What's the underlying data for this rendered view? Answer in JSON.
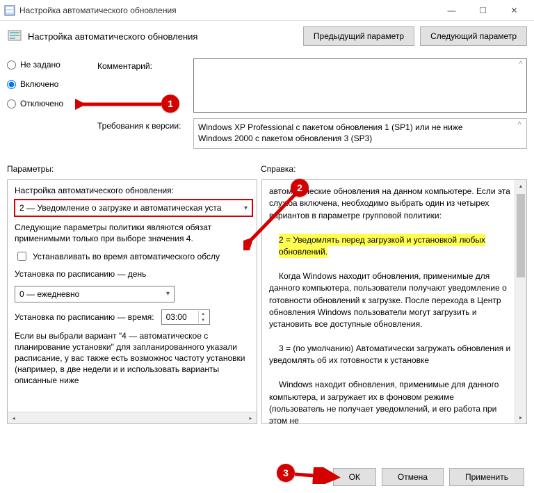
{
  "window": {
    "title": "Настройка автоматического обновления",
    "min": "—",
    "max": "☐",
    "close": "✕"
  },
  "header": {
    "title": "Настройка автоматического обновления",
    "prev_btn": "Предыдущий параметр",
    "next_btn": "Следующий параметр"
  },
  "radios": {
    "not_set": "Не задано",
    "enabled": "Включено",
    "disabled": "Отключено"
  },
  "fields": {
    "comment_label": "Комментарий:",
    "requirements_label": "Требования к версии:",
    "requirements_text_1": "Windows XP Professional с пакетом обновления 1 (SP1) или не ниже",
    "requirements_text_2": "Windows 2000 с пакетом обновления 3 (SP3)"
  },
  "sections": {
    "options": "Параметры:",
    "help": "Справка:"
  },
  "options": {
    "subheader": "Настройка автоматического обновления:",
    "update_mode": "2 — Уведомление о загрузке и автоматическая уста",
    "note_1": "Следующие параметры политики являются обязат",
    "note_2": "применимыми только при выборе значения 4.",
    "chk_label": "Устанавливать во время автоматического обслу",
    "schedule_day_label": "Установка по расписанию — день",
    "schedule_day_value": "0 — ежедневно",
    "schedule_time_label": "Установка по расписанию — время:",
    "schedule_time_value": "03:00",
    "footer_text": "Если вы выбрали вариант \"4 — автоматическое с планирование установки\" для запланированного указали расписание, у вас также есть возможнос частоту установки (например, в две недели и и использовать варианты  описанные ниже"
  },
  "help": {
    "p1": "автоматические обновления на данном компьютере. Если эта служба включена, необходимо выбрать один из четырех вариантов в параметре групповой политики:",
    "p2": "2 = Уведомлять перед загрузкой и установкой любых обновлений.",
    "p3": "Когда Windows находит обновления, применимые для данного компьютера, пользователи получают уведомление о готовности обновлений к загрузке. После перехода в Центр обновления Windows пользователи могут загрузить и установить все доступные обновления.",
    "p4": "3 = (по умолчанию) Автоматически загружать обновления и уведомлять об их готовности к установке",
    "p5": "Windows находит обновления, применимые для данного компьютера, и загружает их в фоновом режиме (пользователь не получает уведомлений, и его работа при этом не"
  },
  "footer": {
    "ok": "ОК",
    "cancel": "Отмена",
    "apply": "Применить"
  },
  "annotations": {
    "a1": "1",
    "a2": "2",
    "a3": "3"
  }
}
